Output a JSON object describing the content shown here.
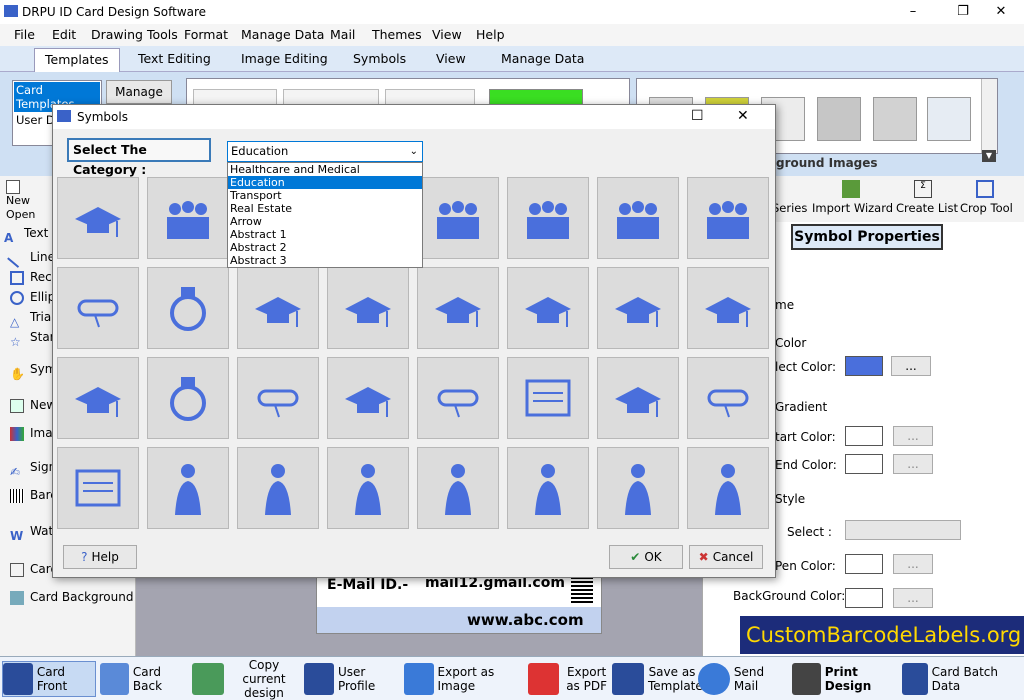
{
  "window": {
    "title": "DRPU ID Card Design Software",
    "min": "–",
    "max": "❐",
    "close": "✕"
  },
  "menu": [
    "File",
    "Edit",
    "Drawing Tools",
    "Format",
    "Manage Data",
    "Mail",
    "Themes",
    "View",
    "Help"
  ],
  "ribbon_tabs": [
    "Templates",
    "Text Editing",
    "Image Editing",
    "Symbols",
    "View",
    "Manage Data"
  ],
  "ribbon": {
    "card_templates": "Card Templates",
    "user_defined": "User Defined",
    "manage": "Manage",
    "bg_label": "ground Images"
  },
  "toolbar_right": [
    "Series",
    "Import Wizard",
    "Create List",
    "Crop Tool"
  ],
  "left_tools": [
    "Text",
    "Line",
    "Rectangle",
    "Ellipse",
    "Triangle",
    "Star",
    "Symbol",
    "New",
    "Image",
    "Signature",
    "Barcode",
    "Watermark",
    "Card Properties",
    "Card Background"
  ],
  "left_top": {
    "new_open": "New Open"
  },
  "right_panel": {
    "header": "Symbol Properties",
    "fill": "me",
    "color": "Color",
    "select_color": "lect Color:",
    "gradient": "Gradient",
    "start_color": "tart Color:",
    "end_color": "End Color:",
    "style": "Style",
    "select": "Select :",
    "pen_color": "Pen Color:",
    "background_color": "BackGround Color:",
    "ellipsis": "...",
    "fill_color": "#4a6fdc"
  },
  "card_preview": {
    "email_label": "E-Mail ID.-",
    "email": "mail12.gmail.com",
    "website": "www.abc.com"
  },
  "dialog": {
    "title": "Symbols",
    "category_label": "Select The Category :",
    "category_value": "Education",
    "help": "Help",
    "ok": "OK",
    "cancel": "Cancel",
    "max": "☐",
    "close": "✕"
  },
  "dropdown_options": [
    "Healthcare and Medical",
    "Education",
    "Transport",
    "Real Estate",
    "Arrow",
    "Abstract 1",
    "Abstract 2",
    "Abstract 3"
  ],
  "symbols": [
    "graduate-hat-throw-icon",
    "family-graduation-icon",
    "hidden-1",
    "hidden-2",
    "two-graduates-icon",
    "three-graduates-icon",
    "group-graduates-icon",
    "sketch-graduates-icon",
    "diploma-tassel-icon",
    "laurel-wreath-icon",
    "mortarboard-flat-icon",
    "mortarboard-1-icon",
    "mortarboard-2-icon",
    "mortarboard-3-icon",
    "mortarboard-outline-icon",
    "mortarboard-4-icon",
    "mortarboard-tassel-icon",
    "class-ring-icon",
    "diploma-scroll-hat-icon",
    "mortarboard-diploma-icon",
    "rolled-diploma-icon",
    "diploma-certificate-icon",
    "hat-diploma-icon",
    "diploma-hand-icon",
    "blank-scroll-icon",
    "graduate-on-books-icon",
    "graduate-figure-1-icon",
    "graduate-figure-2-icon",
    "graduate-figure-3-icon",
    "graduate-man-icon",
    "graduate-woman-icon",
    "graduate-portrait-icon"
  ],
  "statusbar": [
    "Card Front",
    "Card Back",
    "Copy current design",
    "User Profile",
    "Export as Image",
    "Export as PDF",
    "Save as Template",
    "Send Mail",
    "Print Design",
    "Card Batch Data"
  ],
  "watermark": "CustomBarcodeLabels.org",
  "colors": {
    "accent": "#0078d7",
    "symbol": "#4a6fdc"
  }
}
